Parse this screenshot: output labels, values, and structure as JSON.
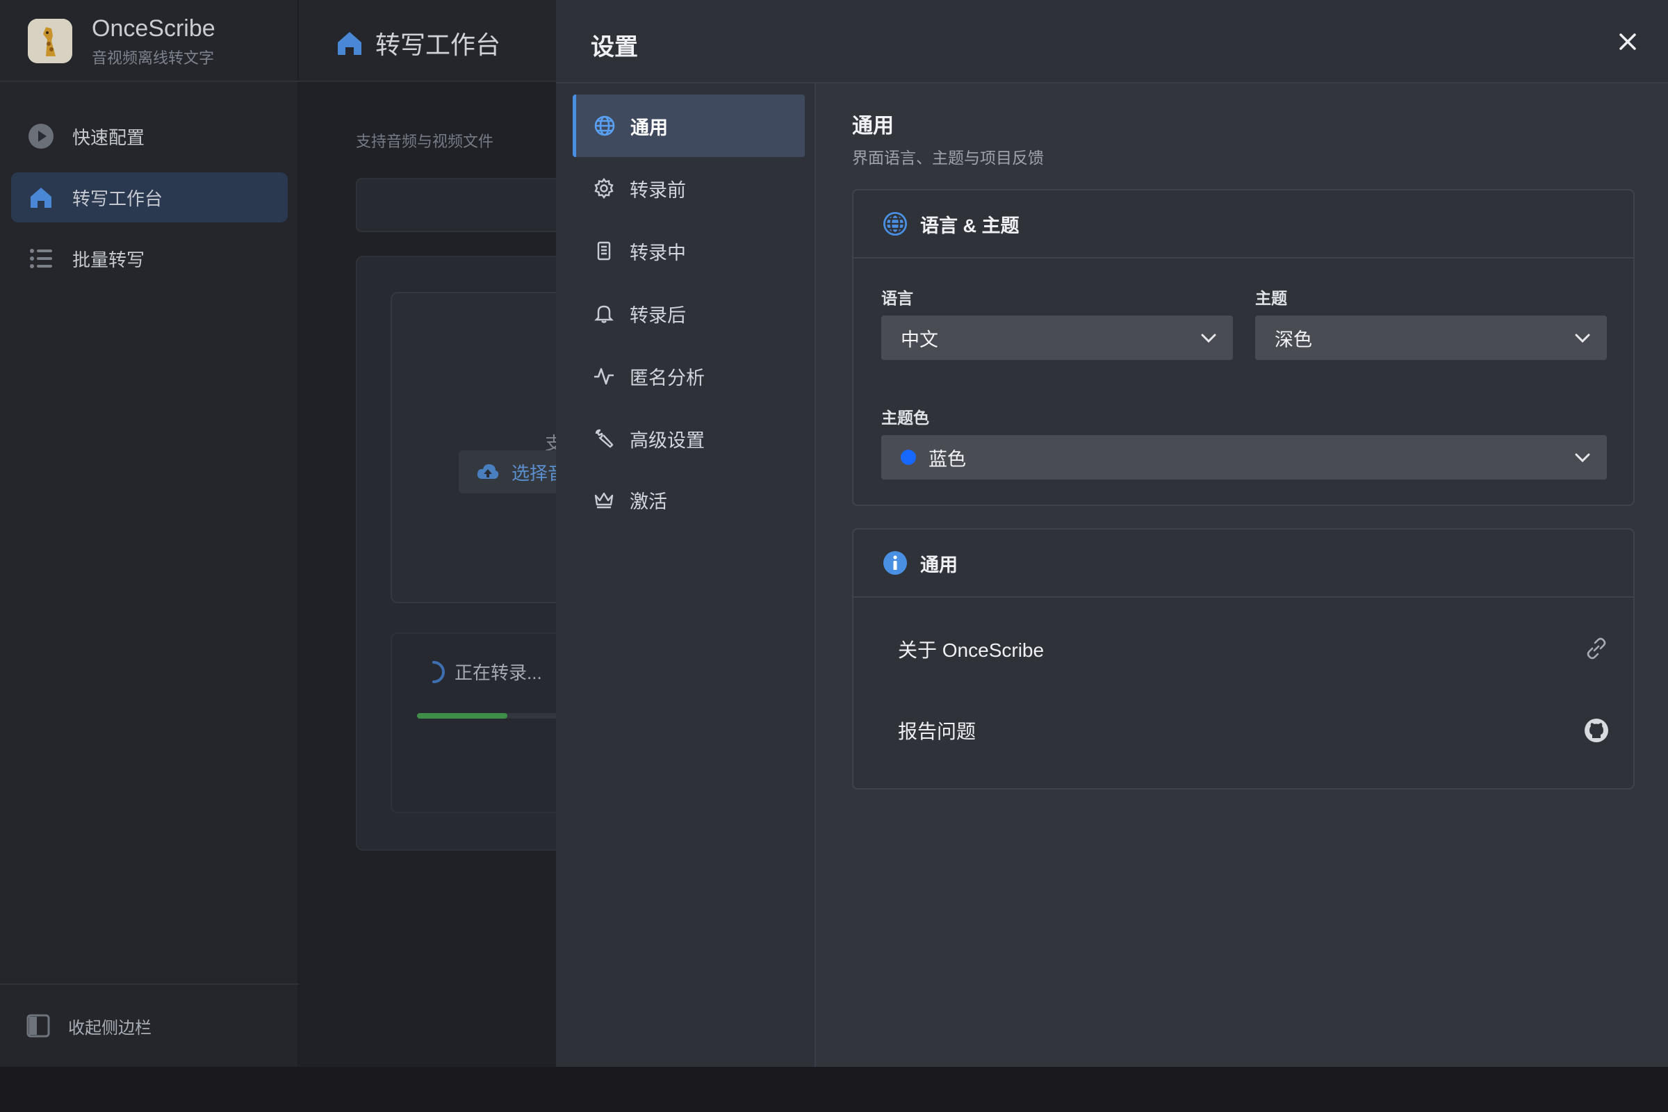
{
  "app": {
    "name": "OnceScribe",
    "subtitle": "音视频离线转文字",
    "logo_icon": "giraffe-logo"
  },
  "sidebar": {
    "items": [
      {
        "label": "快速配置",
        "icon": "play-circle-icon",
        "active": false
      },
      {
        "label": "转写工作台",
        "icon": "home-icon",
        "active": true
      },
      {
        "label": "批量转写",
        "icon": "list-icon",
        "active": false
      }
    ],
    "collapse_label": "收起侧边栏"
  },
  "main": {
    "title": "转写工作台",
    "hint": "支持音频与视频文件",
    "drop_text": "支",
    "upload_label": "选择音",
    "progress_label": "正在转录...",
    "progress_fraction": 0.26
  },
  "settings": {
    "title": "设置",
    "nav": [
      {
        "label": "通用",
        "icon": "globe-icon",
        "active": true
      },
      {
        "label": "转录前",
        "icon": "gear-icon",
        "active": false
      },
      {
        "label": "转录中",
        "icon": "document-icon",
        "active": false
      },
      {
        "label": "转录后",
        "icon": "bell-icon",
        "active": false
      },
      {
        "label": "匿名分析",
        "icon": "activity-icon",
        "active": false
      },
      {
        "label": "高级设置",
        "icon": "wrench-icon",
        "active": false
      },
      {
        "label": "激活",
        "icon": "crown-icon",
        "active": false
      }
    ],
    "section": {
      "title": "通用",
      "subtitle": "界面语言、主题与项目反馈"
    },
    "lang_theme_card": {
      "title": "语言 & 主题",
      "language_label": "语言",
      "language_value": "中文",
      "theme_label": "主题",
      "theme_value": "深色",
      "accent_label": "主题色",
      "accent_value": "蓝色",
      "accent_color": "#1668ff"
    },
    "general_card": {
      "title": "通用",
      "about_label": "关于 OnceScribe",
      "report_label": "报告问题"
    }
  },
  "colors": {
    "accent": "#4a90e2",
    "progress": "#3f8f4a"
  }
}
